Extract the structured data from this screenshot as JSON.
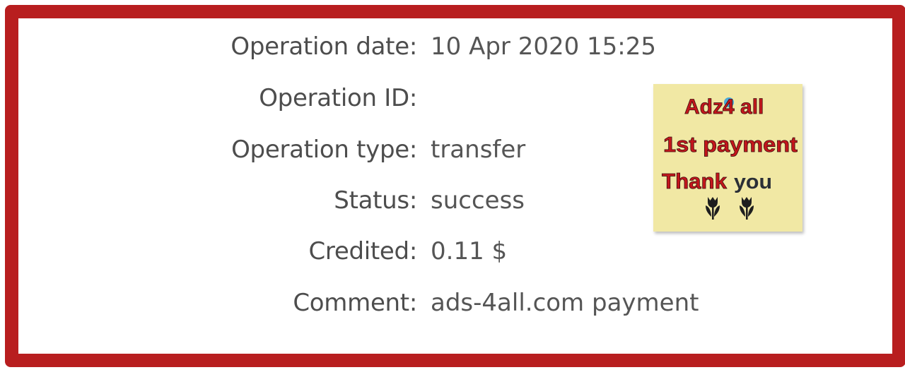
{
  "details": [
    {
      "label": "Operation date:",
      "value": "10 Apr 2020 15:25"
    },
    {
      "label": "Operation ID:",
      "value": ""
    },
    {
      "label": "Operation type:",
      "value": "transfer"
    },
    {
      "label": "Status:",
      "value": "success"
    },
    {
      "label": "Credited:",
      "value": "0.11 $"
    },
    {
      "label": "Comment:",
      "value": "ads-4all.com payment"
    }
  ],
  "sticker": {
    "line1_part1": "Adz",
    "line1_part2": "4 all",
    "line2": "1st payment",
    "line3_part1": "Thank",
    "line3_part2": "you",
    "icon": "tulip-icon",
    "colors": {
      "background": "#f1e8a4",
      "red_text": "#c4161c",
      "dark_text": "#2b2f36",
      "accent_blue": "#4aa8d8"
    }
  },
  "colors": {
    "frame": "#b81e1f",
    "label": "#4d4d4d",
    "value": "#555555"
  }
}
